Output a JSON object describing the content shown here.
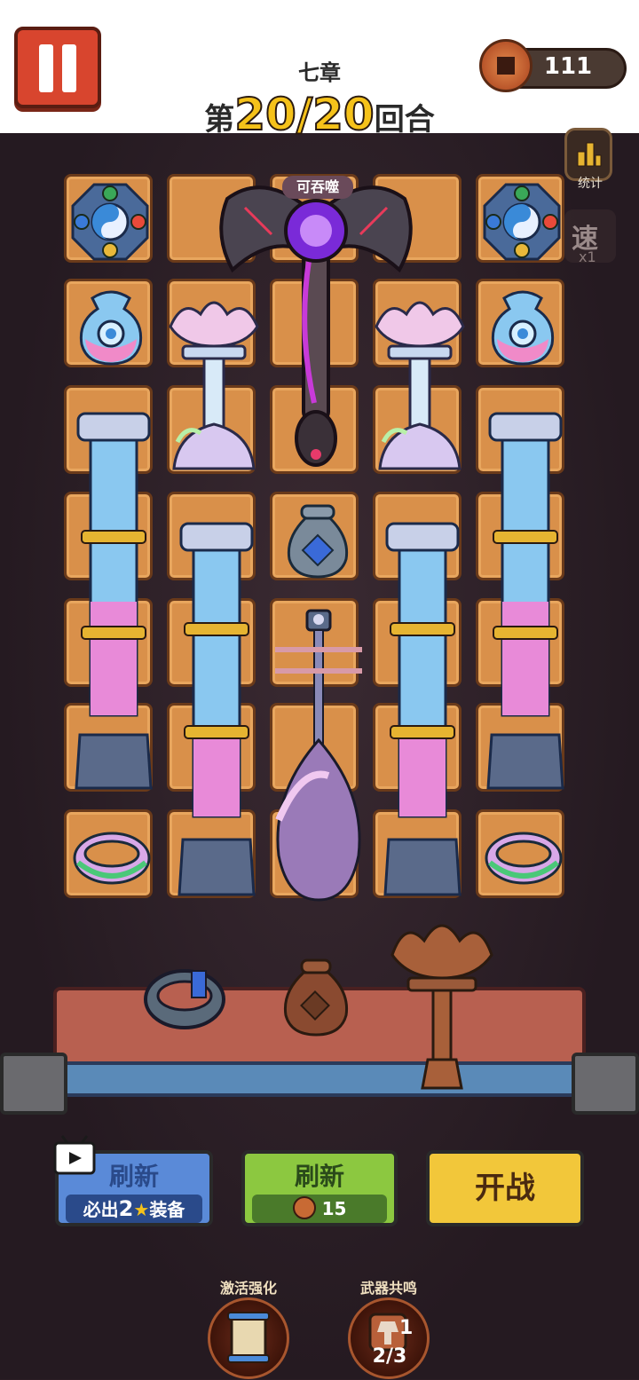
{
  "header": {
    "chapter": "七章",
    "round_prefix": "第",
    "round_current": "20",
    "round_separator": "/",
    "round_total": "20",
    "round_suffix": "回合",
    "coins": "111"
  },
  "side": {
    "stats_label": "统计",
    "speed_label": "速",
    "speed_multiplier": "x1"
  },
  "board": {
    "devour_tag": "可吞噬"
  },
  "buttons": {
    "refresh_ad_title": "刷新",
    "refresh_ad_prefix": "必出",
    "refresh_ad_count": "2",
    "refresh_ad_suffix": "装备",
    "refresh_coin_title": "刷新",
    "refresh_coin_cost": "15",
    "battle_label": "开战"
  },
  "bottom": {
    "activate_label": "激活强化",
    "resonance_label": "武器共鸣",
    "resonance_count": "1",
    "resonance_progress": "2/3"
  },
  "colors": {
    "accent_gold": "#f5c21a",
    "tile": "#d9904a",
    "button_blue": "#5a8ad8",
    "button_green": "#8cc840",
    "button_yellow": "#f2c73a",
    "pause_red": "#d8452e"
  }
}
